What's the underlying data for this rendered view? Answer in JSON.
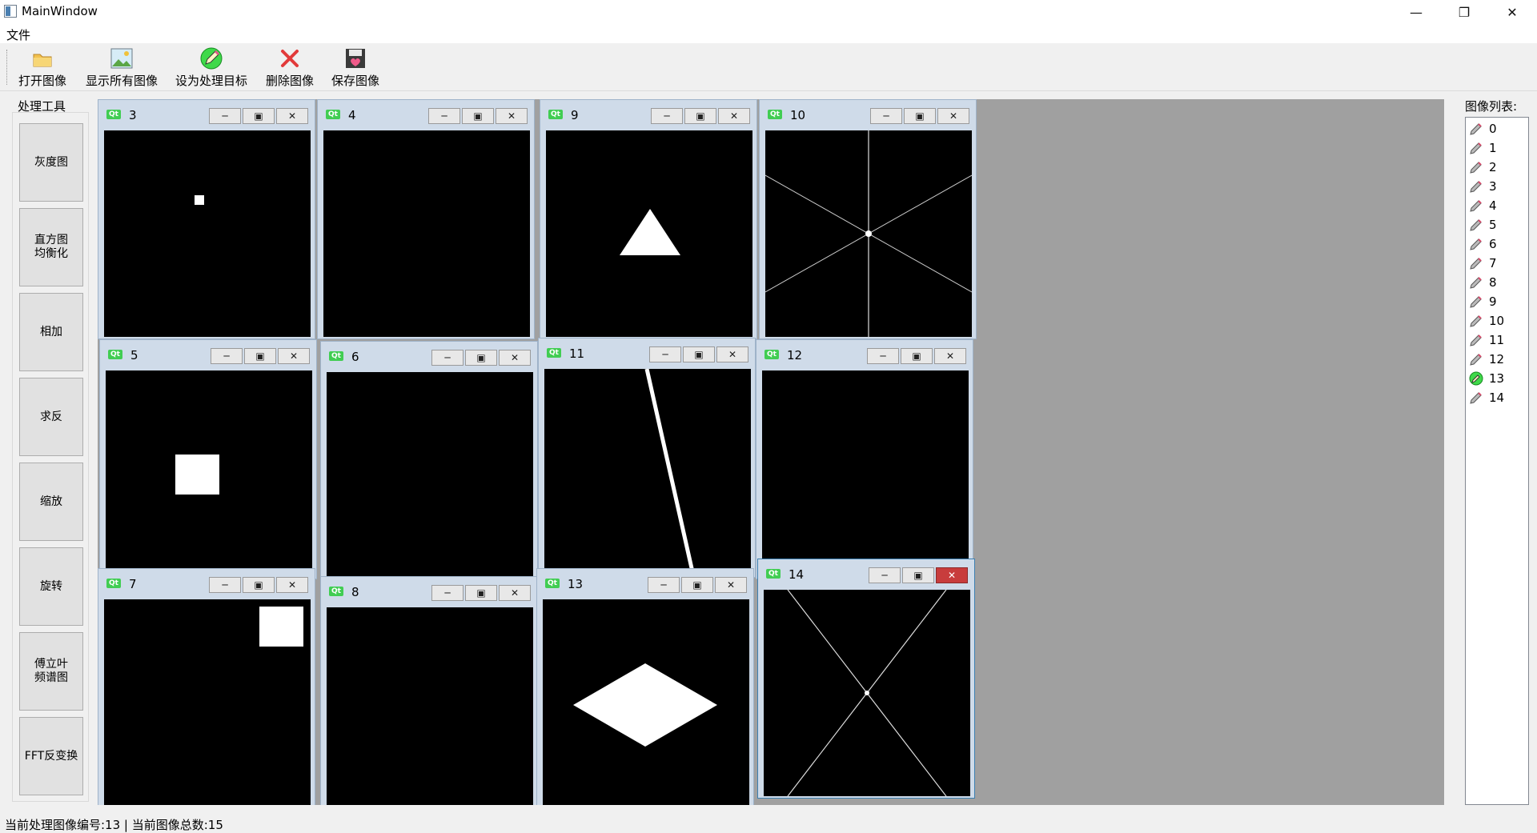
{
  "window": {
    "title": "MainWindow"
  },
  "menu": {
    "file": "文件"
  },
  "toolbar": {
    "open": "打开图像",
    "show_all": "显示所有图像",
    "set_target": "设为处理目标",
    "delete": "删除图像",
    "save": "保存图像"
  },
  "tools": {
    "title": "处理工具",
    "buttons": [
      "灰度图",
      "直方图\n均衡化",
      "相加",
      "求反",
      "缩放",
      "旋转",
      "傅立叶\n频谱图",
      "FFT反变换"
    ]
  },
  "subwindows": [
    {
      "name": "3"
    },
    {
      "name": "4"
    },
    {
      "name": "9"
    },
    {
      "name": "10"
    },
    {
      "name": "5"
    },
    {
      "name": "6"
    },
    {
      "name": "11"
    },
    {
      "name": "12"
    },
    {
      "name": "7"
    },
    {
      "name": "8"
    },
    {
      "name": "13"
    },
    {
      "name": "14"
    }
  ],
  "qt_badge": "Qt",
  "image_list": {
    "title": "图像列表:",
    "items": [
      "0",
      "1",
      "2",
      "3",
      "4",
      "5",
      "6",
      "7",
      "8",
      "9",
      "10",
      "11",
      "12",
      "13",
      "14"
    ],
    "selected": "13"
  },
  "colors": {
    "qt_green": "#41cd52",
    "mdi_bg": "#a0a0a0",
    "close_active": "#c83c3c"
  },
  "status": {
    "text": "当前处理图像编号:13 | 当前图像总数:15"
  }
}
